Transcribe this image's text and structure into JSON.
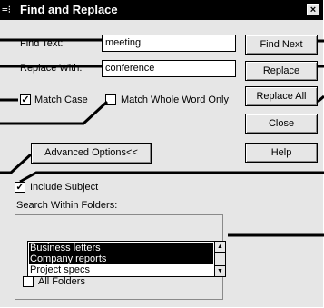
{
  "dialog": {
    "title": "Find and Replace",
    "close_label": "×"
  },
  "fields": {
    "find_label": "Find Text:",
    "find_value": "meeting",
    "replace_label": "Replace With:",
    "replace_value": "conference"
  },
  "options": {
    "match_case_label": "Match Case",
    "match_case_checked": true,
    "match_whole_word_label": "Match Whole Word Only",
    "match_whole_word_checked": false,
    "advanced_label": "Advanced Options<<",
    "include_subject_label": "Include Subject",
    "include_subject_checked": true
  },
  "buttons": {
    "find_next": "Find Next",
    "replace": "Replace",
    "replace_all": "Replace All",
    "close": "Close",
    "help": "Help"
  },
  "folders": {
    "group_label": "Search Within Folders:",
    "items": [
      "Business letters",
      "Company reports",
      "Project specs"
    ],
    "selected": [
      "Business letters",
      "Company reports"
    ],
    "all_folders_label": "All Folders",
    "all_folders_checked": false
  }
}
